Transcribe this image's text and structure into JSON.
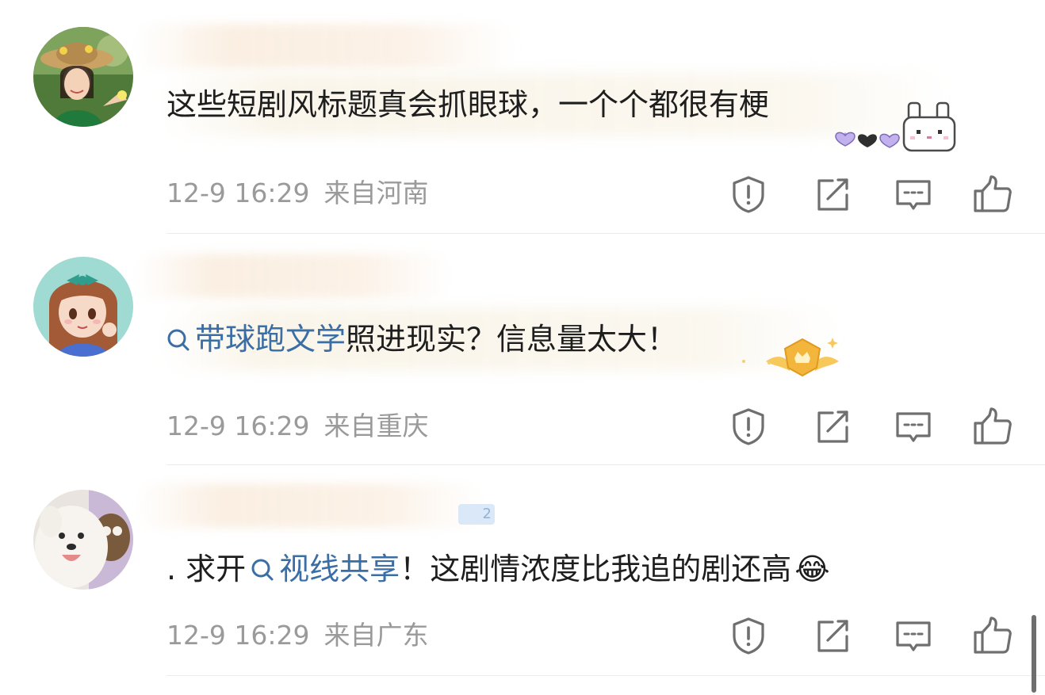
{
  "comments": [
    {
      "text": "这些短剧风标题真会抓眼球，一个个都很有梗",
      "time": "12-9 16:29",
      "location": "来自河南",
      "avatar": "woman-straw-hat-avatar",
      "badge": "pixel-bunny-hearts-badge"
    },
    {
      "topic": "带球跑文学",
      "text": "照进现实？信息量太大！",
      "time": "12-9 16:29",
      "location": "来自重庆",
      "avatar": "anime-girl-avatar",
      "badge": "gold-crown-wings-badge"
    },
    {
      "prefix": ". 求开",
      "topic": "视线共享",
      "text": "！这剧情浓度比我追的剧还高",
      "emoji": "😂",
      "time": "12-9 16:29",
      "location": "来自广东",
      "avatar": "white-dog-avatar",
      "level_badge": "2"
    }
  ],
  "actions": {
    "report_icon": "report-shield-icon",
    "share_icon": "share-icon",
    "reply_icon": "reply-icon",
    "like_icon": "like-thumb-icon"
  },
  "colors": {
    "topic": "#3b6ea5",
    "meta": "#9a9a9a",
    "icon": "#6f6f6f"
  }
}
